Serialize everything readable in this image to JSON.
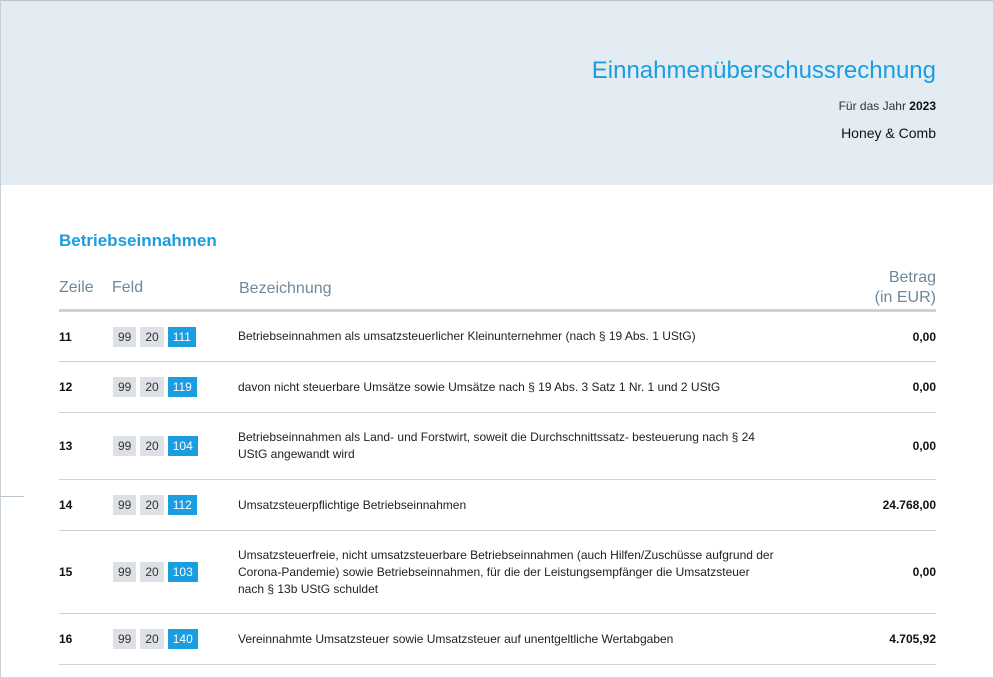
{
  "header": {
    "title": "Einnahmenüberschussrechnung",
    "year_prefix": "Für das Jahr",
    "year": "2023",
    "company": "Honey & Comb"
  },
  "section": {
    "title": "Betriebseinnahmen"
  },
  "table": {
    "columns": {
      "zeile": "Zeile",
      "feld": "Feld",
      "bezeichnung": "Bezeichnung",
      "betrag_line1": "Betrag",
      "betrag_line2": "(in EUR)"
    },
    "rows": [
      {
        "zeile": "11",
        "feld": [
          "99",
          "20",
          "111"
        ],
        "bezeichnung": "Betriebseinnahmen als umsatzsteuerlicher Kleinunternehmer (nach § 19 Abs. 1 UStG)",
        "betrag": "0,00"
      },
      {
        "zeile": "12",
        "feld": [
          "99",
          "20",
          "119"
        ],
        "bezeichnung": "davon nicht steuerbare Umsätze sowie Umsätze nach § 19 Abs. 3 Satz 1 Nr. 1 und 2 UStG",
        "betrag": "0,00"
      },
      {
        "zeile": "13",
        "feld": [
          "99",
          "20",
          "104"
        ],
        "bezeichnung": "Betriebseinnahmen als Land- und Forstwirt, soweit die Durchschnittssatz- besteuerung nach § 24 UStG angewandt wird",
        "betrag": "0,00"
      },
      {
        "zeile": "14",
        "feld": [
          "99",
          "20",
          "112"
        ],
        "bezeichnung": "Umsatzsteuerpflichtige Betriebseinnahmen",
        "betrag": "24.768,00"
      },
      {
        "zeile": "15",
        "feld": [
          "99",
          "20",
          "103"
        ],
        "bezeichnung": "Umsatzsteuerfreie, nicht umsatzsteuerbare Betriebseinnahmen (auch Hilfen/Zuschüsse aufgrund der Corona-Pandemie) sowie Betriebseinnahmen, für die der Leistungsempfänger die Umsatzsteuer nach § 13b UStG schuldet",
        "betrag": "0,00"
      },
      {
        "zeile": "16",
        "feld": [
          "99",
          "20",
          "140"
        ],
        "bezeichnung": "Vereinnahmte Umsatzsteuer sowie Umsatzsteuer auf unentgeltliche Wertabgaben",
        "betrag": "4.705,92"
      }
    ]
  }
}
